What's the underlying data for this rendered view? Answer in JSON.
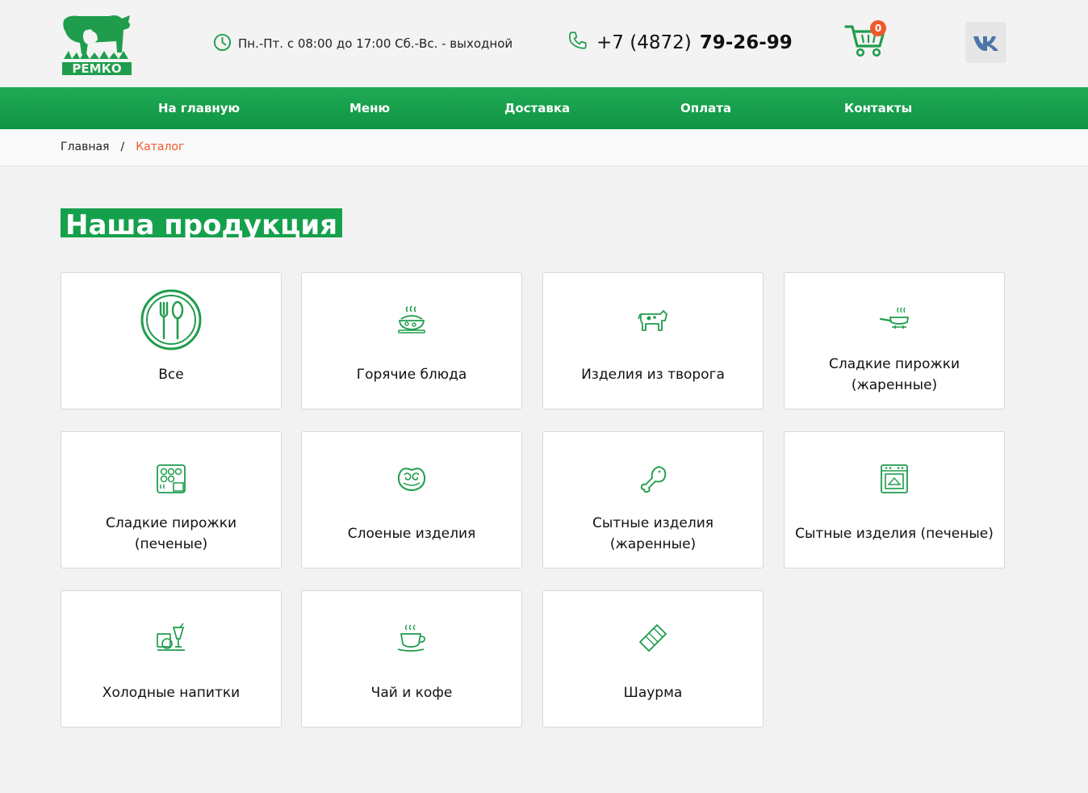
{
  "header": {
    "logo_text": "РЕМКО",
    "hours": "Пн.-Пт. с 08:00 до 17:00 Сб.-Вс. - выходной",
    "phone_prefix": "+7 (4872)",
    "phone_main": "79-26-99",
    "cart_count": "0",
    "vk_icon": "vk-icon"
  },
  "nav": {
    "items": [
      {
        "label": "На главную"
      },
      {
        "label": "Меню"
      },
      {
        "label": "Доставка"
      },
      {
        "label": "Оплата"
      },
      {
        "label": "Контакты"
      }
    ]
  },
  "breadcrumb": {
    "home": "Главная",
    "separator": "/",
    "current": "Каталог"
  },
  "page_title": "Наша продукция",
  "categories": [
    {
      "label": "Все",
      "icon": "utensils-icon"
    },
    {
      "label": "Горячие блюда",
      "icon": "hot-dish-icon"
    },
    {
      "label": "Изделия из творога",
      "icon": "cow-icon"
    },
    {
      "label": "Сладкие пирожки (жаренные)",
      "icon": "frying-pan-icon"
    },
    {
      "label": "Сладкие пирожки (печеные)",
      "icon": "baking-tray-icon"
    },
    {
      "label": "Слоеные изделия",
      "icon": "puff-pastry-icon"
    },
    {
      "label": "Сытные изделия (жаренные)",
      "icon": "drumstick-icon"
    },
    {
      "label": "Сытные изделия (печеные)",
      "icon": "oven-icon"
    },
    {
      "label": "Холодные напитки",
      "icon": "cold-drinks-icon"
    },
    {
      "label": "Чай и кофе",
      "icon": "coffee-cup-icon"
    },
    {
      "label": "Шаурма",
      "icon": "shawarma-icon"
    }
  ],
  "colors": {
    "brand_green": "#15a04c",
    "accent_orange": "#ef5a2b"
  }
}
